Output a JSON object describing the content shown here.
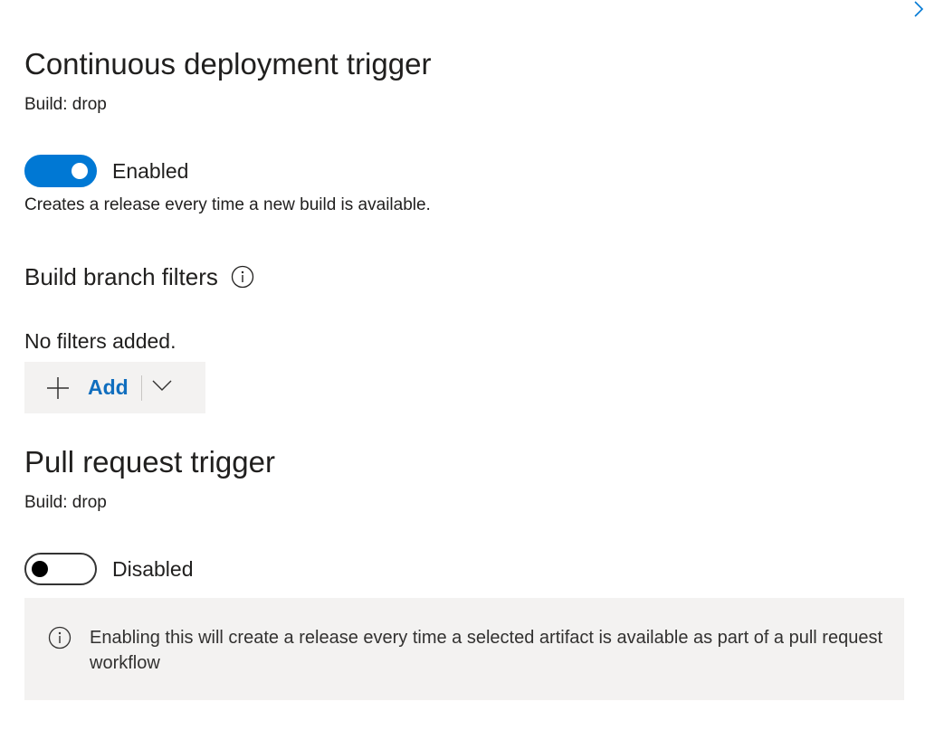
{
  "panel": {
    "collapse_icon": "chevron-right-icon"
  },
  "cd_trigger": {
    "title": "Continuous deployment trigger",
    "build": "Build: drop",
    "toggle_state": "on",
    "toggle_label": "Enabled",
    "description": "Creates a release every time a new build is available."
  },
  "branch_filters": {
    "title": "Build branch filters",
    "info_icon": "info-icon",
    "empty_text": "No filters added.",
    "add_label": "Add",
    "add_icon": "plus-icon",
    "dropdown_icon": "chevron-down-icon"
  },
  "pr_trigger": {
    "title": "Pull request trigger",
    "build": "Build: drop",
    "toggle_state": "off",
    "toggle_label": "Disabled",
    "info_icon": "info-icon",
    "info_message": "Enabling this will create a release every time a selected artifact is available as part of a pull request workflow"
  },
  "colors": {
    "accent": "#0078d4",
    "link": "#106ebe",
    "panel_gray": "#f3f2f1"
  }
}
